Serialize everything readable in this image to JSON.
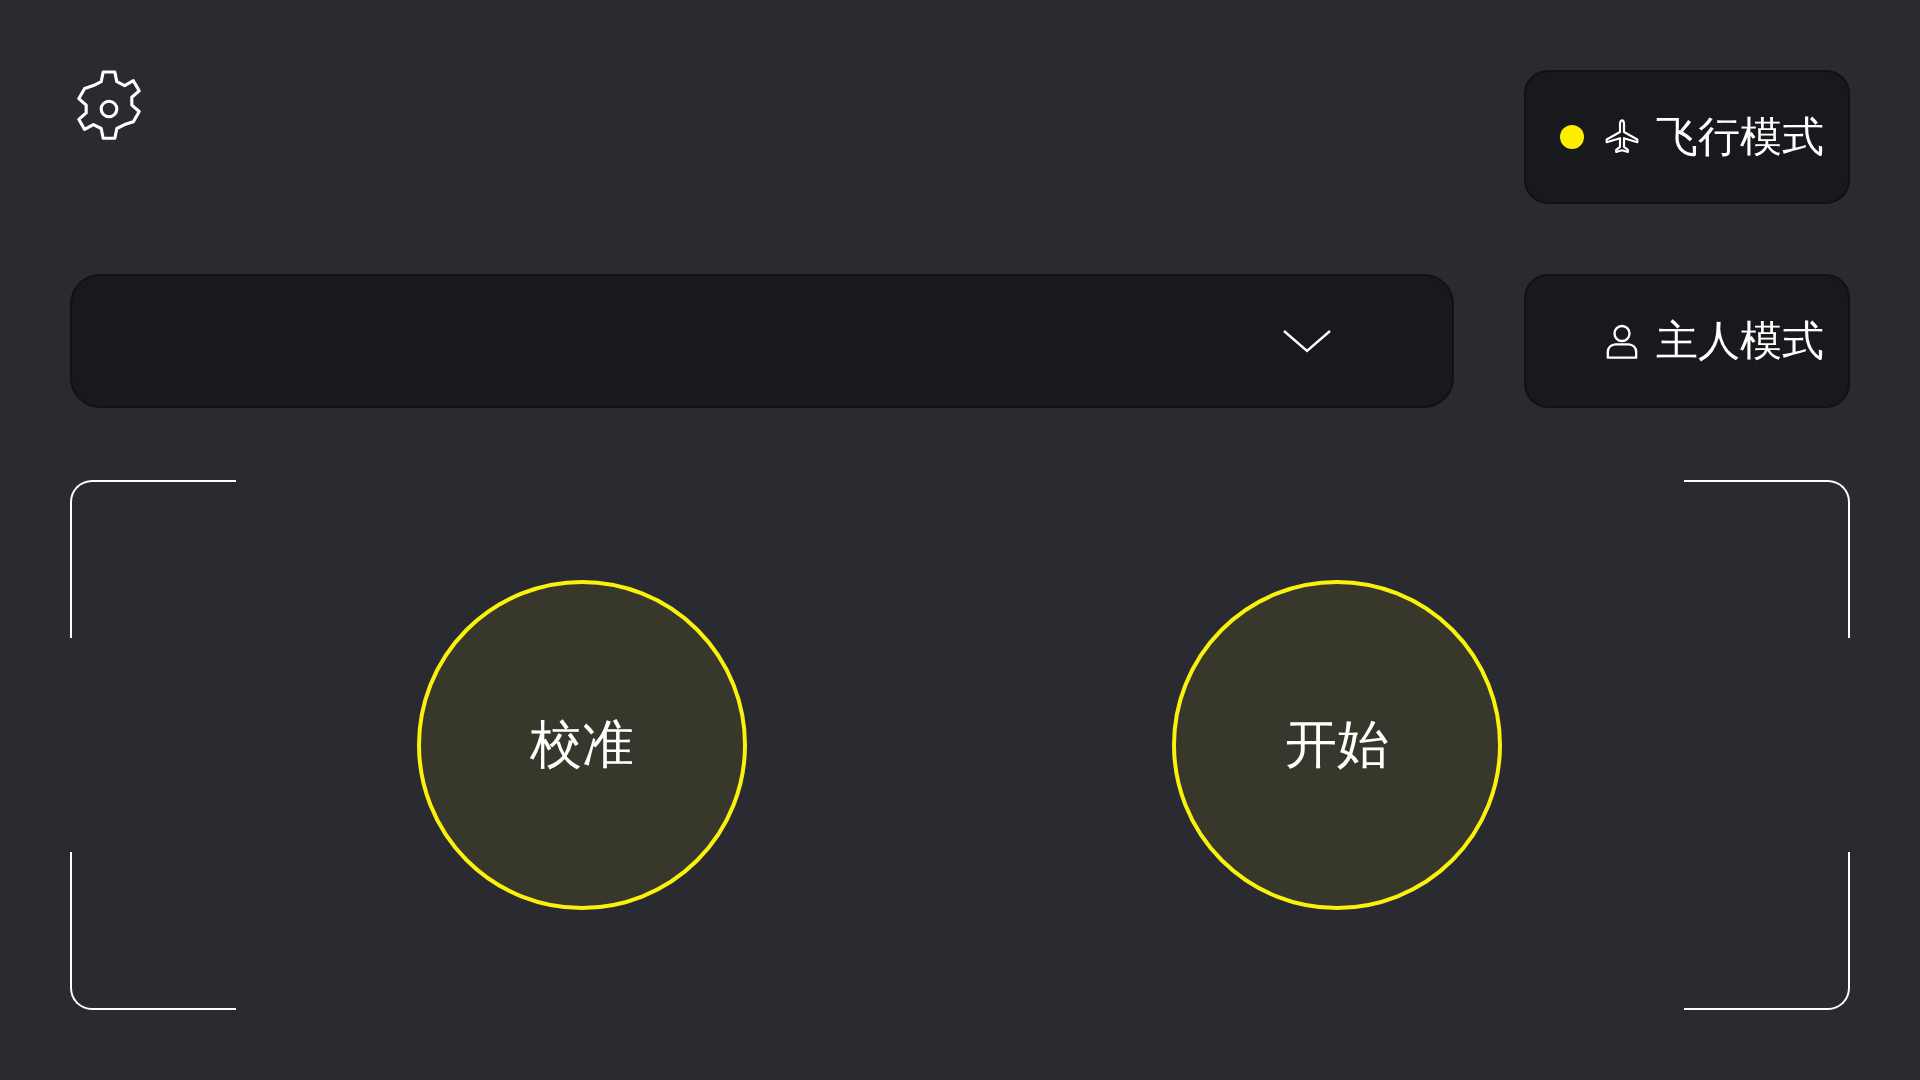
{
  "modes": [
    {
      "kind": "flight",
      "label": "飞行模式",
      "selected": true
    },
    {
      "kind": "owner",
      "label": "主人模式",
      "selected": false
    }
  ],
  "dropdown": {
    "expanded": false
  },
  "actions": [
    {
      "label": "校准"
    },
    {
      "label": "开始"
    }
  ]
}
